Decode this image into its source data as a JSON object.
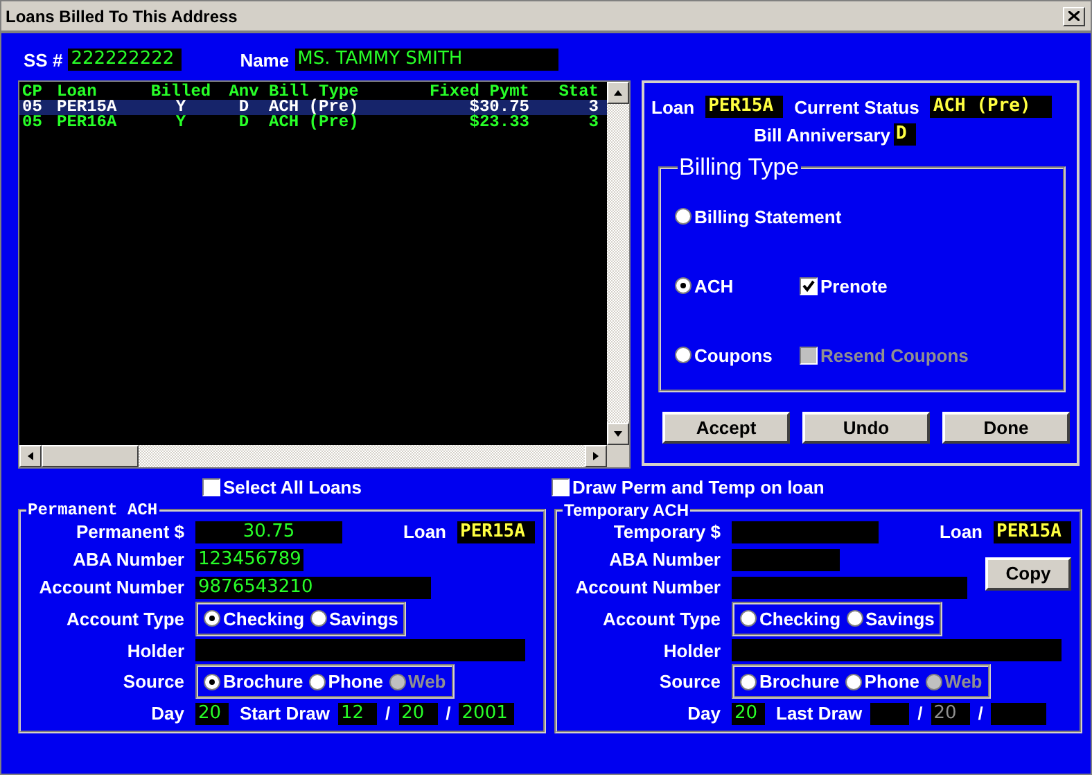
{
  "window": {
    "title": "Loans Billed To This Address"
  },
  "ss": {
    "label": "SS #",
    "value": "222222222"
  },
  "name": {
    "label": "Name",
    "value": "MS. TAMMY  SMITH"
  },
  "loans": {
    "columns": [
      "CP",
      "Loan",
      "Billed",
      "Anv",
      "Bill Type",
      "Fixed Pymt",
      "Stat"
    ],
    "rows": [
      {
        "cells": [
          "05",
          "PER15A",
          "Y",
          "D",
          "ACH (Pre)",
          "$30.75",
          "3"
        ],
        "selected": true
      },
      {
        "cells": [
          "05",
          "PER16A",
          "Y",
          "D",
          "ACH (Pre)",
          "$23.33",
          "3"
        ],
        "selected": false
      }
    ]
  },
  "status": {
    "loan": {
      "label": "Loan",
      "value": "PER15A"
    },
    "current_status": {
      "label": "Current Status",
      "value": "ACH (Pre)"
    },
    "bill_anniversary": {
      "label": "Bill Anniversary",
      "value": "D"
    }
  },
  "billing_type": {
    "title": "Billing Type",
    "rows": [
      {
        "radio": {
          "label": "Billing Statement",
          "selected": false
        }
      },
      {
        "radio": {
          "label": "ACH",
          "selected": true
        },
        "checkbox": {
          "label": "Prenote",
          "checked": true,
          "disabled": false
        }
      },
      {
        "radio": {
          "label": "Coupons",
          "selected": false
        },
        "checkbox": {
          "label": "Resend Coupons",
          "checked": false,
          "disabled": true
        }
      }
    ]
  },
  "buttons": [
    "Accept",
    "Undo",
    "Done"
  ],
  "select_all": {
    "label": "Select All Loans",
    "checked": false
  },
  "draw_perm_temp": {
    "label": "Draw Perm and Temp on loan",
    "checked": false
  },
  "permanent": {
    "title": "Permanent ACH",
    "amount": {
      "label": "Permanent $",
      "value": "30.75"
    },
    "loan": {
      "label": "Loan",
      "value": "PER15A"
    },
    "aba": {
      "label": "ABA Number",
      "value": "123456789"
    },
    "account": {
      "label": "Account Number",
      "value": "9876543210"
    },
    "account_type": {
      "label": "Account Type",
      "options": [
        {
          "label": "Checking",
          "selected": true,
          "disabled": false
        },
        {
          "label": "Savings",
          "selected": false,
          "disabled": false
        }
      ]
    },
    "holder": {
      "label": "Holder"
    },
    "source": {
      "label": "Source",
      "options": [
        {
          "label": "Brochure",
          "selected": true,
          "disabled": false
        },
        {
          "label": "Phone",
          "selected": false,
          "disabled": false
        },
        {
          "label": "Web",
          "selected": false,
          "disabled": true
        }
      ]
    },
    "day": {
      "label": "Day",
      "value": "20"
    },
    "draw": {
      "label": "Start Draw",
      "parts": [
        {
          "kind": "field",
          "value": "12",
          "disabled": false
        },
        {
          "kind": "sep",
          "text": "/"
        },
        {
          "kind": "field",
          "value": "20",
          "disabled": false
        },
        {
          "kind": "sep",
          "text": "/"
        },
        {
          "kind": "field",
          "value": "2001",
          "disabled": false
        }
      ]
    }
  },
  "temporary": {
    "title": "Temporary ACH",
    "amount": {
      "label": "Temporary $"
    },
    "loan": {
      "label": "Loan",
      "value": "PER15A"
    },
    "aba": {
      "label": "ABA Number"
    },
    "account": {
      "label": "Account Number"
    },
    "copy_button": "Copy",
    "account_type": {
      "label": "Account Type",
      "options": [
        {
          "label": "Checking",
          "selected": false,
          "disabled": false
        },
        {
          "label": "Savings",
          "selected": false,
          "disabled": false
        }
      ]
    },
    "holder": {
      "label": "Holder"
    },
    "source": {
      "label": "Source",
      "options": [
        {
          "label": "Brochure",
          "selected": false,
          "disabled": false
        },
        {
          "label": "Phone",
          "selected": false,
          "disabled": false
        },
        {
          "label": "Web",
          "selected": false,
          "disabled": true
        }
      ]
    },
    "day": {
      "label": "Day",
      "value": "20"
    },
    "draw": {
      "label": "Last Draw",
      "parts": [
        {
          "kind": "field"
        },
        {
          "kind": "sep",
          "text": "/"
        },
        {
          "kind": "field",
          "value": "20",
          "disabled": true
        },
        {
          "kind": "sep",
          "text": "/"
        },
        {
          "kind": "field"
        }
      ]
    }
  }
}
